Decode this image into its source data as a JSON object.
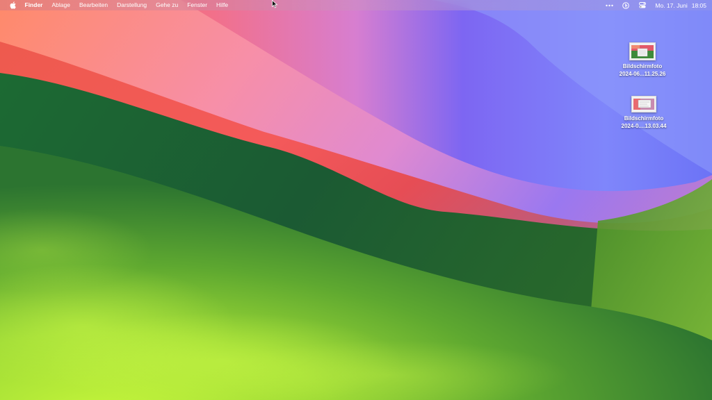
{
  "menubar": {
    "apple_icon": "apple-logo-icon",
    "app_name": "Finder",
    "menus": [
      "Ablage",
      "Bearbeiten",
      "Darstellung",
      "Gehe zu",
      "Fenster",
      "Hilfe"
    ],
    "status_icons": [
      "more-dots-icon",
      "siri-icon",
      "control-center-icon"
    ],
    "date": "Mo. 17. Juni",
    "time": "18:05"
  },
  "desktop_items": [
    {
      "line1": "Bildschirmfoto",
      "line2": "2024-06...11.25.26",
      "icon": "screenshot-file-icon"
    },
    {
      "line1": "Bildschirmfoto",
      "line2": "2024-0....13.03.44",
      "icon": "screenshot-file-icon"
    }
  ],
  "wallpaper": {
    "name": "Sonoma",
    "colors": {
      "green_dark": "#1e5e30",
      "green_light": "#b8ec3a",
      "red": "#ef4f55",
      "orange": "#f07a55",
      "pink": "#f58aa8",
      "purple": "#8a6af5",
      "blue": "#6a78f8"
    }
  }
}
